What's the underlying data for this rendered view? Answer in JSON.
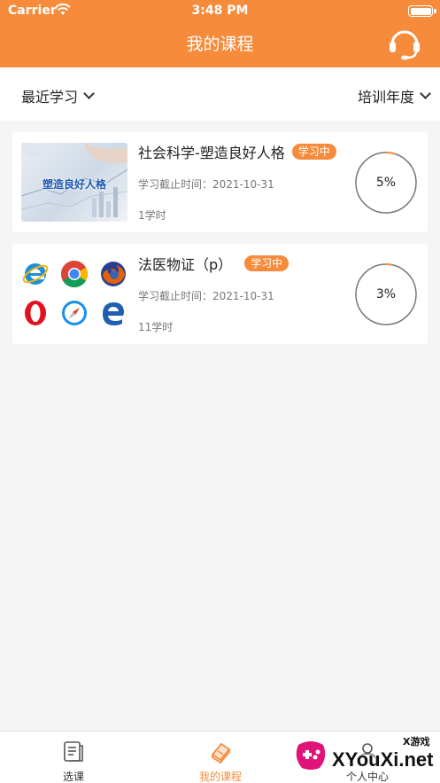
{
  "status_bar": {
    "carrier": "Carrier",
    "time": "3:48 PM"
  },
  "header": {
    "title": "我的课程",
    "support_icon": "headset-icon"
  },
  "filters": {
    "left": "最近学习",
    "right": "培训年度"
  },
  "courses": [
    {
      "title": "社会科学-塑造良好人格",
      "status": "学习中",
      "deadline": "学习截止时间：2021-10-31",
      "hours": "1学时",
      "progress_label": "5%",
      "progress": 0.05,
      "thumbnail_text": "塑造良好人格"
    },
    {
      "title": "法医物证（p）",
      "status": "学习中",
      "deadline": "学习截止时间：2021-10-31",
      "hours": "11学时",
      "progress_label": "3%",
      "progress": 0.03,
      "thumbnail_icons": [
        "ie-icon",
        "chrome-icon",
        "firefox-icon",
        "opera-icon",
        "safari-icon",
        "edge-icon"
      ]
    }
  ],
  "tabs": [
    {
      "label": "选课",
      "icon": "document-icon",
      "active": false
    },
    {
      "label": "我的课程",
      "icon": "book-icon",
      "active": true
    },
    {
      "label": "个人中心",
      "icon": "person-icon",
      "active": false
    }
  ],
  "watermark": {
    "text": "XYouXi.net",
    "small": "X游戏"
  },
  "colors": {
    "accent": "#f68b3c",
    "background": "#f5f5f5",
    "ring": "#777777"
  }
}
